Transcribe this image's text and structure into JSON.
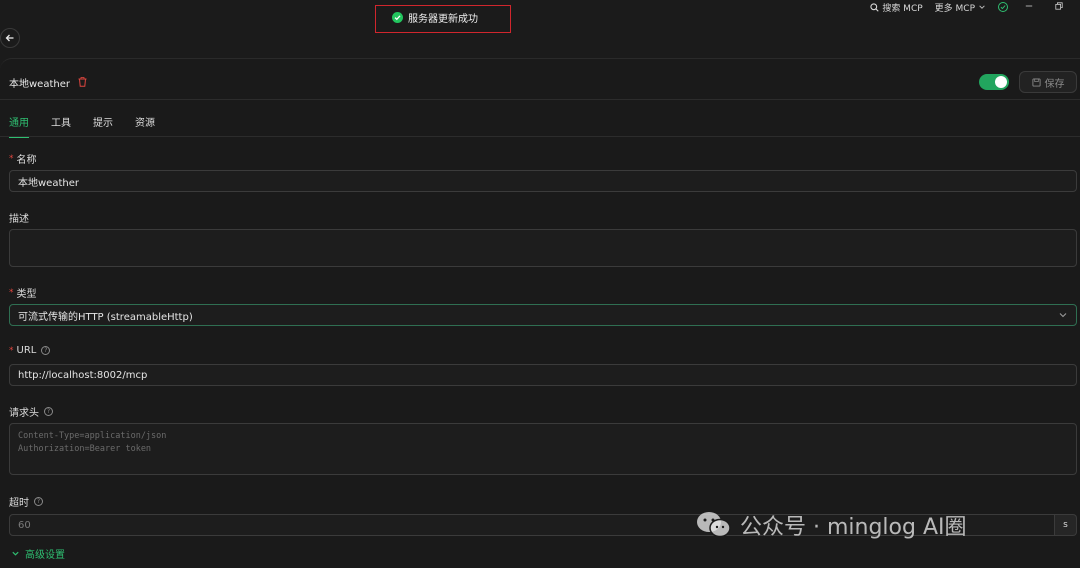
{
  "topbar": {
    "search_mcp": "搜索 MCP",
    "more_mcp": "更多 MCP"
  },
  "toast": {
    "message": "服务器更新成功"
  },
  "header": {
    "server_name": "本地weather",
    "save_label": "保存",
    "enabled": true
  },
  "tabs": [
    {
      "label": "通用",
      "active": true
    },
    {
      "label": "工具",
      "active": false
    },
    {
      "label": "提示",
      "active": false
    },
    {
      "label": "资源",
      "active": false
    }
  ],
  "form": {
    "name_label": "名称",
    "name_value": "本地weather",
    "desc_label": "描述",
    "desc_value": "",
    "type_label": "类型",
    "type_value": "可流式传输的HTTP (streamableHttp)",
    "url_label": "URL",
    "url_value": "http://localhost:8002/mcp",
    "headers_label": "请求头",
    "headers_placeholder_1": "Content-Type=application/json",
    "headers_placeholder_2": "Authorization=Bearer token",
    "timeout_label": "超时",
    "timeout_placeholder": "60",
    "timeout_unit": "s",
    "advanced_label": "高级设置"
  },
  "watermark": {
    "text": "公众号 · minglog AI圈"
  },
  "colors": {
    "accent": "#2fbf71",
    "danger": "#e0463f",
    "highlight_border": "#d0262d"
  }
}
